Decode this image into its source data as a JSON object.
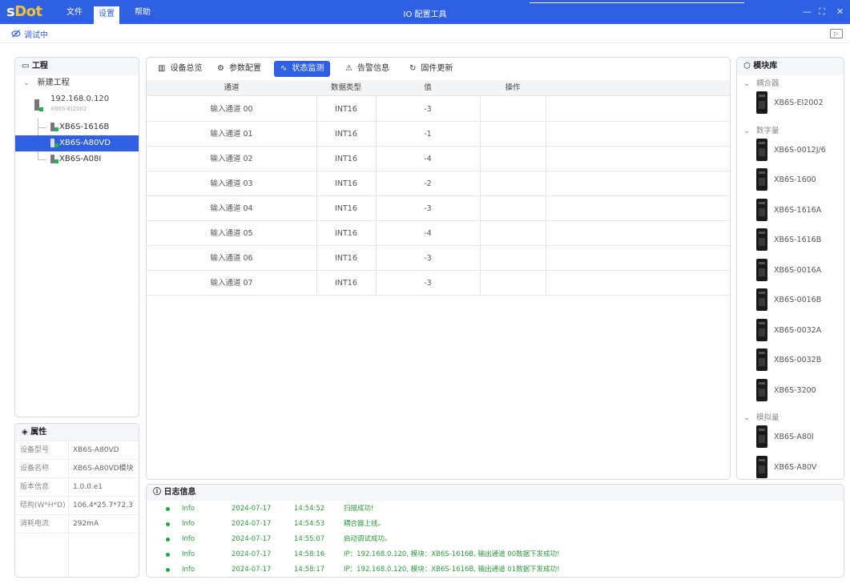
{
  "app": {
    "logo_s": "s",
    "logo_rest": "Dot",
    "title": "IO 配置工具",
    "menus": [
      "文件",
      "设置",
      "帮助"
    ],
    "active_menu": "设置"
  },
  "status": {
    "debug_label": "调试中"
  },
  "project": {
    "header": "工程",
    "root": "新建工程",
    "coupler_ip": "192.168.0.120",
    "coupler_model": "XB6S-EI2002",
    "modules": [
      "XB6S-1616B",
      "XB6S-A80VD",
      "XB6S-A08I"
    ],
    "selected": "XB6S-A80VD"
  },
  "properties": {
    "header": "属性",
    "rows": [
      {
        "key": "设备型号",
        "value": "XB6S-A80VD"
      },
      {
        "key": "设备名称",
        "value": "XB6S-A80VD模块"
      },
      {
        "key": "版本信息",
        "value": "1.0.0.e1"
      },
      {
        "key": "结构(W*H*D)",
        "value": "106.4*25.7*72.3"
      },
      {
        "key": "消耗电流",
        "value": "292mA"
      }
    ]
  },
  "tabs": [
    {
      "label": "设备总览",
      "icon": "columns-icon"
    },
    {
      "label": "参数配置",
      "icon": "gear-icon"
    },
    {
      "label": "状态监测",
      "icon": "pulse-icon"
    },
    {
      "label": "告警信息",
      "icon": "warning-icon"
    },
    {
      "label": "固件更新",
      "icon": "refresh-icon"
    }
  ],
  "active_tab": "状态监测",
  "table": {
    "columns": [
      "通道",
      "数据类型",
      "值",
      "操作"
    ],
    "rows": [
      {
        "channel": "输入通道 00",
        "type": "INT16",
        "value": "-3"
      },
      {
        "channel": "输入通道 01",
        "type": "INT16",
        "value": "-1"
      },
      {
        "channel": "输入通道 02",
        "type": "INT16",
        "value": "-4"
      },
      {
        "channel": "输入通道 03",
        "type": "INT16",
        "value": "-2"
      },
      {
        "channel": "输入通道 04",
        "type": "INT16",
        "value": "-3"
      },
      {
        "channel": "输入通道 05",
        "type": "INT16",
        "value": "-4"
      },
      {
        "channel": "输入通道 06",
        "type": "INT16",
        "value": "-3"
      },
      {
        "channel": "输入通道 07",
        "type": "INT16",
        "value": "-3"
      }
    ]
  },
  "library": {
    "header": "模块库",
    "groups": [
      {
        "name": "耦合器",
        "items": [
          "XB6S-EI2002"
        ]
      },
      {
        "name": "数字量",
        "items": [
          "XB6S-0012J/6",
          "XB6S-1600",
          "XB6S-1616A",
          "XB6S-1616B",
          "XB6S-0016A",
          "XB6S-0016B",
          "XB6S-0032A",
          "XB6S-0032B",
          "XB6S-3200"
        ]
      },
      {
        "name": "模拟量",
        "items": [
          "XB6S-A80I",
          "XB6S-A80V"
        ]
      }
    ]
  },
  "log": {
    "header": "日志信息",
    "entries": [
      {
        "level": "Info",
        "date": "2024-07-17",
        "time": "14:54:52",
        "msg": "扫描成功!"
      },
      {
        "level": "Info",
        "date": "2024-07-17",
        "time": "14:54:53",
        "msg": "耦合器上线。"
      },
      {
        "level": "Info",
        "date": "2024-07-17",
        "time": "14:55:07",
        "msg": "启动调试成功。"
      },
      {
        "level": "Info",
        "date": "2024-07-17",
        "time": "14:58:16",
        "msg": "IP：192.168.0.120, 模块：XB6S-1616B, 输出通道 00数据下发成功!"
      },
      {
        "level": "Info",
        "date": "2024-07-17",
        "time": "14:58:17",
        "msg": "IP：192.168.0.120, 模块：XB6S-1616B, 输出通道 01数据下发成功!"
      }
    ]
  },
  "colors": {
    "accent": "#2f5fe3",
    "success": "#22a447"
  }
}
